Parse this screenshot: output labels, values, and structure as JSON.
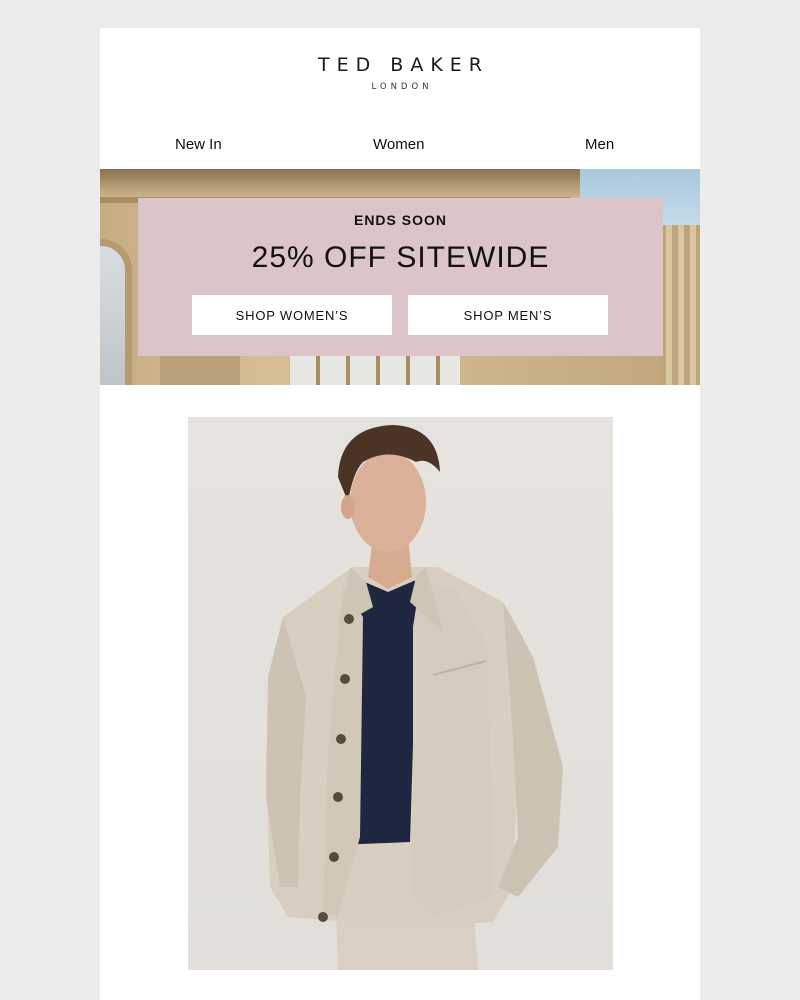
{
  "brand": {
    "name": "TED BAKER",
    "city": "LONDON"
  },
  "nav": {
    "items": [
      "New In",
      "Women",
      "Men"
    ]
  },
  "promo": {
    "eyebrow": "ENDS SOON",
    "headline": "25% OFF SITEWIDE",
    "buttons": [
      "SHOP WOMEN’S",
      "SHOP MEN’S"
    ]
  },
  "colors": {
    "background": "#ececec",
    "email_background": "#ffffff",
    "promo_box": "#dcc5c9",
    "button": "#ffffff",
    "text": "#111111"
  },
  "icons": []
}
